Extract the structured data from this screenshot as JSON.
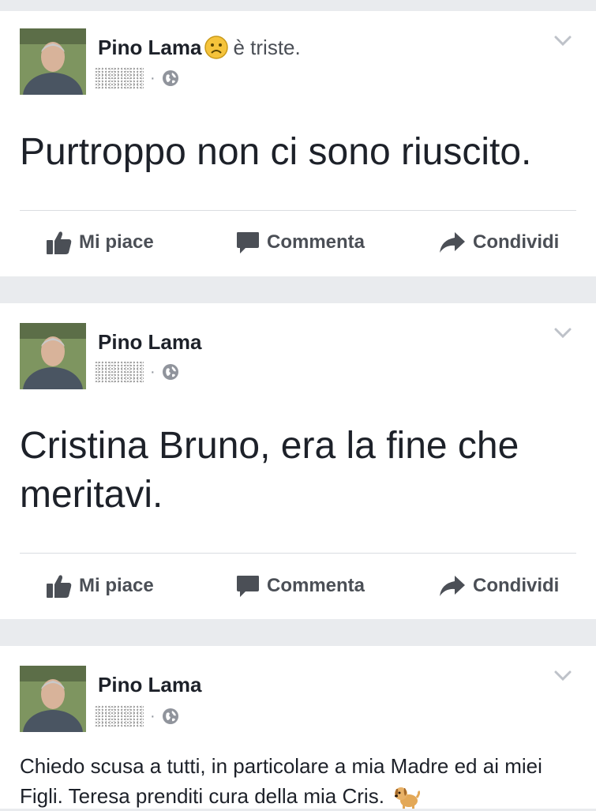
{
  "posts": [
    {
      "author": "Pino Lama",
      "feeling": "è triste.",
      "text": "Purtroppo non ci sono riuscito."
    },
    {
      "author": "Pino Lama",
      "text": "Cristina Bruno, era la fine che meritavi."
    },
    {
      "author": "Pino Lama",
      "text": "Chiedo scusa a tutti, in particolare a mia Madre ed ai miei Figli. Teresa prenditi cura della mia Cris."
    }
  ],
  "actions": {
    "like": "Mi piace",
    "comment": "Commenta",
    "share": "Condividi"
  },
  "meta_separator": "·",
  "icons": {
    "feeling": "sad-face-icon",
    "audience": "globe-icon",
    "menu": "chevron-down-icon",
    "like": "thumbs-up-icon",
    "comment": "speech-bubble-icon",
    "share": "share-arrow-icon",
    "emoji": "dog-emoji-icon"
  },
  "colors": {
    "background": "#e9ebee",
    "card": "#ffffff",
    "text": "#1d2129",
    "secondary": "#4b4f56",
    "muted": "#90949c"
  }
}
